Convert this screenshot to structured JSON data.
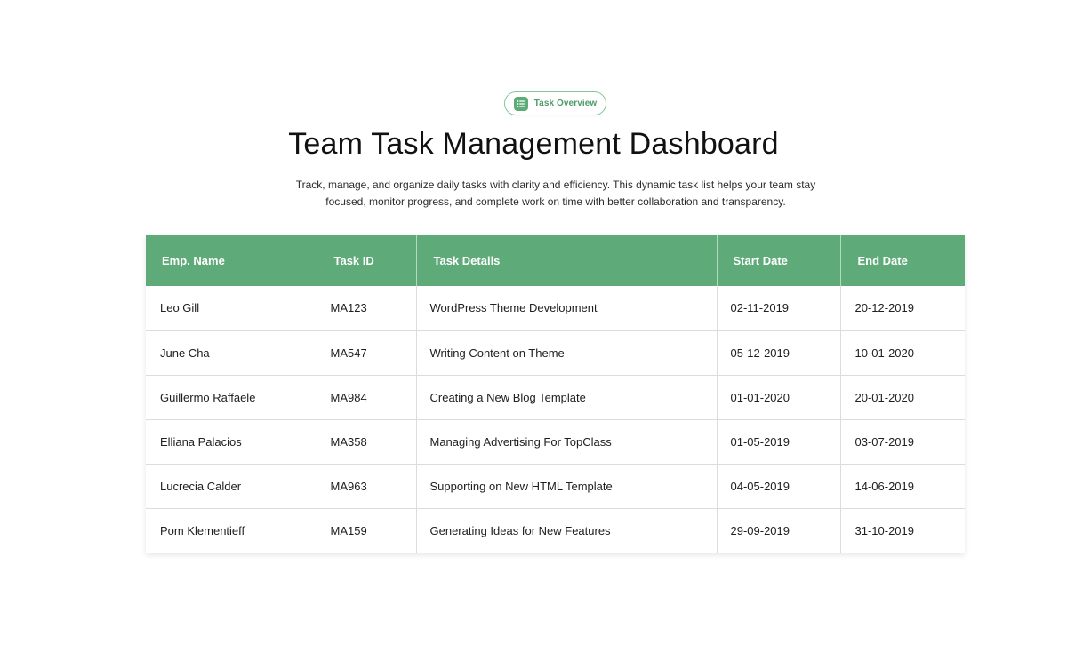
{
  "badge": {
    "label": "Task Overview",
    "icon": "list-icon"
  },
  "header": {
    "title": "Team Task Management Dashboard",
    "subtitle": "Track, manage, and organize daily tasks with clarity and efficiency. This dynamic task list helps your team stay focused, monitor progress, and complete work on time with better collaboration and transparency."
  },
  "table": {
    "columns": [
      "Emp. Name",
      "Task ID",
      "Task Details",
      "Start Date",
      "End Date"
    ],
    "rows": [
      [
        "Leo Gill",
        "MA123",
        "WordPress Theme Development",
        "02-11-2019",
        "20-12-2019"
      ],
      [
        "June Cha",
        "MA547",
        "Writing Content on Theme",
        "05-12-2019",
        "10-01-2020"
      ],
      [
        "Guillermo Raffaele",
        "MA984",
        "Creating a New Blog Template",
        "01-01-2020",
        "20-01-2020"
      ],
      [
        "Elliana Palacios",
        "MA358",
        "Managing Advertising For TopClass",
        "01-05-2019",
        "03-07-2019"
      ],
      [
        "Lucrecia Calder",
        "MA963",
        "Supporting on New HTML Template",
        "04-05-2019",
        "14-06-2019"
      ],
      [
        "Pom Klementieff",
        "MA159",
        "Generating Ideas for New Features",
        "29-09-2019",
        "31-10-2019"
      ]
    ]
  },
  "colors": {
    "accent": "#5eaa79",
    "badge_border": "#86c49a",
    "badge_text": "#4f9b69"
  }
}
